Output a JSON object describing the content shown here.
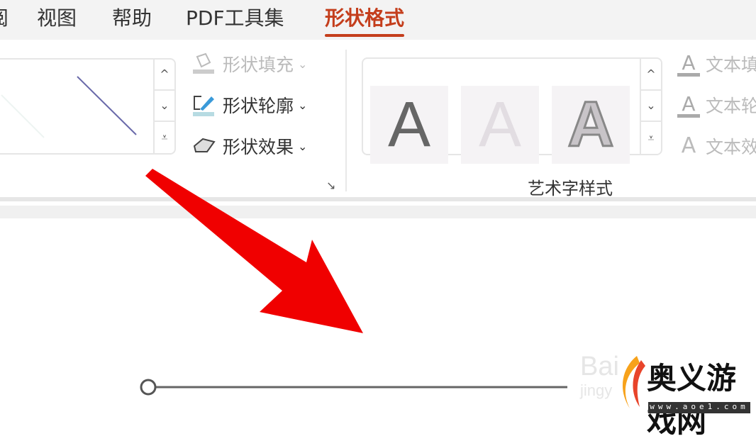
{
  "tabs": [
    {
      "label": "阅"
    },
    {
      "label": "视图"
    },
    {
      "label": "帮助"
    },
    {
      "label": "PDF工具集"
    },
    {
      "label": "形状格式",
      "active": true
    }
  ],
  "shape_styles": {
    "fill": "形状填充",
    "outline": "形状轮廓",
    "effects": "形状效果",
    "scroll_up": "^",
    "scroll_down": "⌄",
    "more": "⩡"
  },
  "wordart": {
    "group_label": "艺术字样式",
    "sample": "A",
    "text_fill": "文本填",
    "text_outline": "文本轮",
    "text_effects": "文本效"
  },
  "watermark": {
    "baidu": "Bai",
    "jingyan": "jingy",
    "site_name": "奥义游戏网",
    "site_url": "www.aoe1.com"
  },
  "colors": {
    "accent": "#c43e1c",
    "arrow": "#f00000",
    "line": "#666666"
  }
}
